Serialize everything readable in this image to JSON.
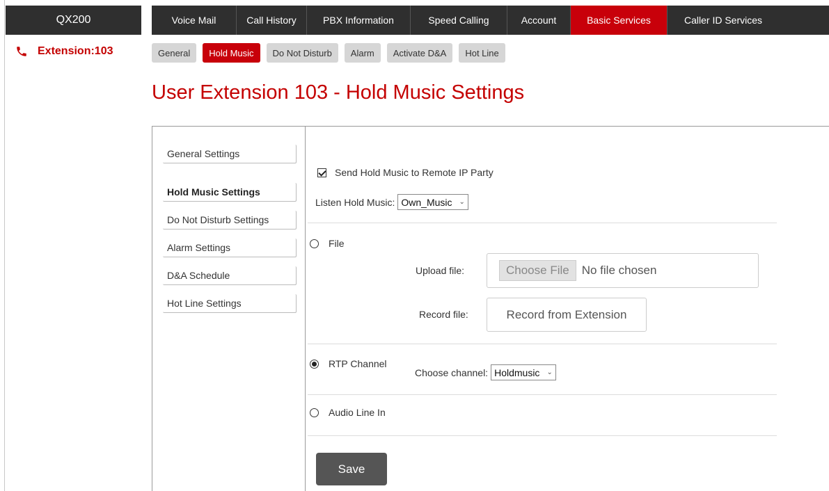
{
  "brand": {
    "name": "QX200"
  },
  "extension": {
    "label": "Extension:103",
    "icon": "phone-icon"
  },
  "topnav": {
    "tabs": [
      {
        "label": "Voice Mail",
        "active": false
      },
      {
        "label": "Call History",
        "active": false
      },
      {
        "label": "PBX Information",
        "active": false
      },
      {
        "label": "Speed Calling",
        "active": false
      },
      {
        "label": "Account",
        "active": false
      },
      {
        "label": "Basic Services",
        "active": true
      },
      {
        "label": "Caller ID Services",
        "active": false
      }
    ]
  },
  "subnav": {
    "tabs": [
      {
        "label": "General",
        "active": false
      },
      {
        "label": "Hold Music",
        "active": true
      },
      {
        "label": "Do Not Disturb",
        "active": false
      },
      {
        "label": "Alarm",
        "active": false
      },
      {
        "label": "Activate D&A",
        "active": false
      },
      {
        "label": "Hot Line",
        "active": false
      }
    ]
  },
  "page": {
    "title": "User Extension 103 - Hold Music Settings"
  },
  "sidemenu": {
    "items": [
      {
        "label": "General Settings",
        "active": false
      },
      {
        "label": "Hold Music Settings",
        "active": true
      },
      {
        "label": "Do Not Disturb Settings",
        "active": false
      },
      {
        "label": "Alarm Settings",
        "active": false
      },
      {
        "label": "D&A Schedule",
        "active": false
      },
      {
        "label": "Hot Line Settings",
        "active": false
      }
    ]
  },
  "form": {
    "send_hold_music": {
      "label": "Send Hold Music to Remote IP Party",
      "checked": true
    },
    "listen_hold_music": {
      "label": "Listen Hold Music:",
      "value": "Own_Music"
    },
    "file_option": {
      "label": "File",
      "selected": false
    },
    "upload_file": {
      "label": "Upload file:",
      "button": "Choose File",
      "status": "No file chosen"
    },
    "record_file": {
      "label": "Record file:",
      "button": "Record from Extension"
    },
    "rtp_option": {
      "label": "RTP Channel",
      "selected": true
    },
    "choose_channel": {
      "label": "Choose channel:",
      "value": "Holdmusic"
    },
    "audio_line_option": {
      "label": "Audio Line In",
      "selected": false
    },
    "save": {
      "label": "Save"
    }
  },
  "colors": {
    "accent": "#c8000a",
    "nav_bg": "#2f2f2f",
    "subtab_bg": "#d6d6d6",
    "save_bg": "#555555"
  }
}
